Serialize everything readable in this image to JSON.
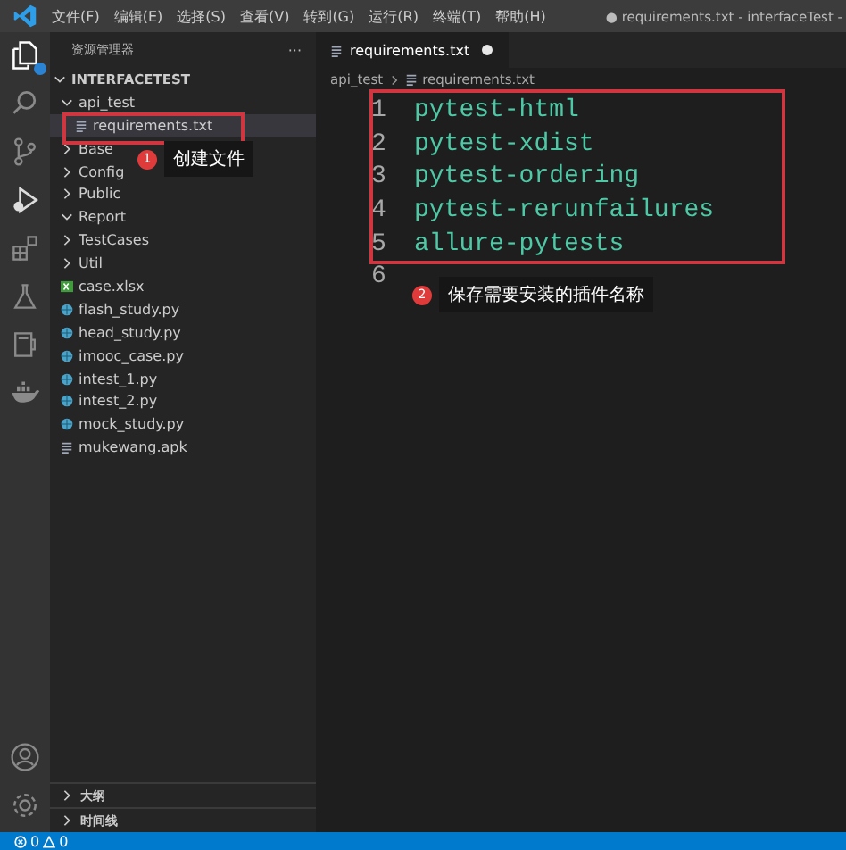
{
  "window": {
    "title": "● requirements.txt - interfaceTest -"
  },
  "menu": [
    "文件(F)",
    "编辑(E)",
    "选择(S)",
    "查看(V)",
    "转到(G)",
    "运行(R)",
    "终端(T)",
    "帮助(H)"
  ],
  "explorer": {
    "title": "资源管理器",
    "more": "···",
    "root": {
      "label": "INTERFACETEST",
      "kind": "folder",
      "expanded": true,
      "selected": false,
      "children": [
        {
          "label": "api_test",
          "kind": "folder",
          "expanded": true,
          "selected": false,
          "children": [
            {
              "label": "requirements.txt",
              "kind": "text",
              "selected": true
            }
          ]
        },
        {
          "label": "Base",
          "kind": "folder",
          "expanded": false,
          "selected": false
        },
        {
          "label": "Config",
          "kind": "folder",
          "expanded": false,
          "selected": false
        },
        {
          "label": "Public",
          "kind": "folder",
          "expanded": false,
          "selected": false
        },
        {
          "label": "Report",
          "kind": "folder",
          "expanded": true,
          "selected": false
        },
        {
          "label": "TestCases",
          "kind": "folder",
          "expanded": false,
          "selected": false
        },
        {
          "label": "Util",
          "kind": "folder",
          "expanded": false,
          "selected": false
        },
        {
          "label": "case.xlsx",
          "kind": "excel",
          "selected": false
        },
        {
          "label": "flash_study.py",
          "kind": "python",
          "selected": false
        },
        {
          "label": "head_study.py",
          "kind": "python",
          "selected": false
        },
        {
          "label": "imooc_case.py",
          "kind": "python",
          "selected": false
        },
        {
          "label": "intest_1.py",
          "kind": "python",
          "selected": false
        },
        {
          "label": "intest_2.py",
          "kind": "python",
          "selected": false
        },
        {
          "label": "mock_study.py",
          "kind": "python",
          "selected": false
        },
        {
          "label": "mukewang.apk",
          "kind": "text",
          "selected": false
        }
      ]
    }
  },
  "panels": [
    {
      "label": "大纲",
      "expanded": false
    },
    {
      "label": "时间线",
      "expanded": false
    }
  ],
  "editor": {
    "tab": {
      "label": "requirements.txt",
      "modified": true
    },
    "breadcrumb": [
      "api_test",
      "requirements.txt"
    ],
    "lines": [
      {
        "number": "1",
        "text": "pytest-html"
      },
      {
        "number": "2",
        "text": "pytest-xdist"
      },
      {
        "number": "3",
        "text": "pytest-ordering"
      },
      {
        "number": "4",
        "text": "pytest-rerunfailures"
      },
      {
        "number": "5",
        "text": "allure-pytests"
      },
      {
        "number": "6"
      }
    ]
  },
  "annotations": [
    {
      "number": "1",
      "text": "创建文件"
    },
    {
      "number": "2",
      "text": "保存需要安装的插件名称"
    }
  ],
  "status_bar": {
    "errors": "0",
    "warnings": "0"
  }
}
